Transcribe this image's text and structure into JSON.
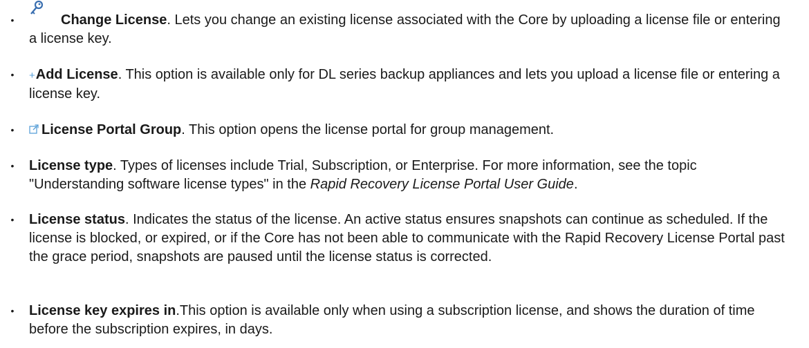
{
  "items": [
    {
      "icon": "key-icon",
      "title": "Change License",
      "text": ". Lets you change an existing license associated with the Core by uploading a license file or entering a license key."
    },
    {
      "icon": "plus-icon",
      "title": "Add License",
      "text": ". This option is available only for DL series backup appliances and lets you upload a license file or entering a license key."
    },
    {
      "icon": "external-link-icon",
      "title": "License Portal Group",
      "text": ". This option opens the license portal for group management."
    },
    {
      "title": "License type",
      "text_before": ". Types of licenses include Trial, Subscription, or Enterprise. For more information, see the topic \"Understanding software license types\" in the ",
      "text_italic": "Rapid Recovery License Portal User Guide",
      "text_after": "."
    },
    {
      "title": "License status",
      "text": ". Indicates the status of the license. An active status ensures snapshots can continue as scheduled. If the license is blocked, or expired, or if the Core has not been able to communicate with the Rapid Recovery License Portal past the grace period, snapshots are paused until the license status is corrected."
    },
    {
      "title": "License key expires in",
      "text": ".This option is available only when using a subscription license, and shows the duration of time before the subscription expires, in days."
    }
  ],
  "bullet_glyph": "•",
  "plus_glyph": "+"
}
